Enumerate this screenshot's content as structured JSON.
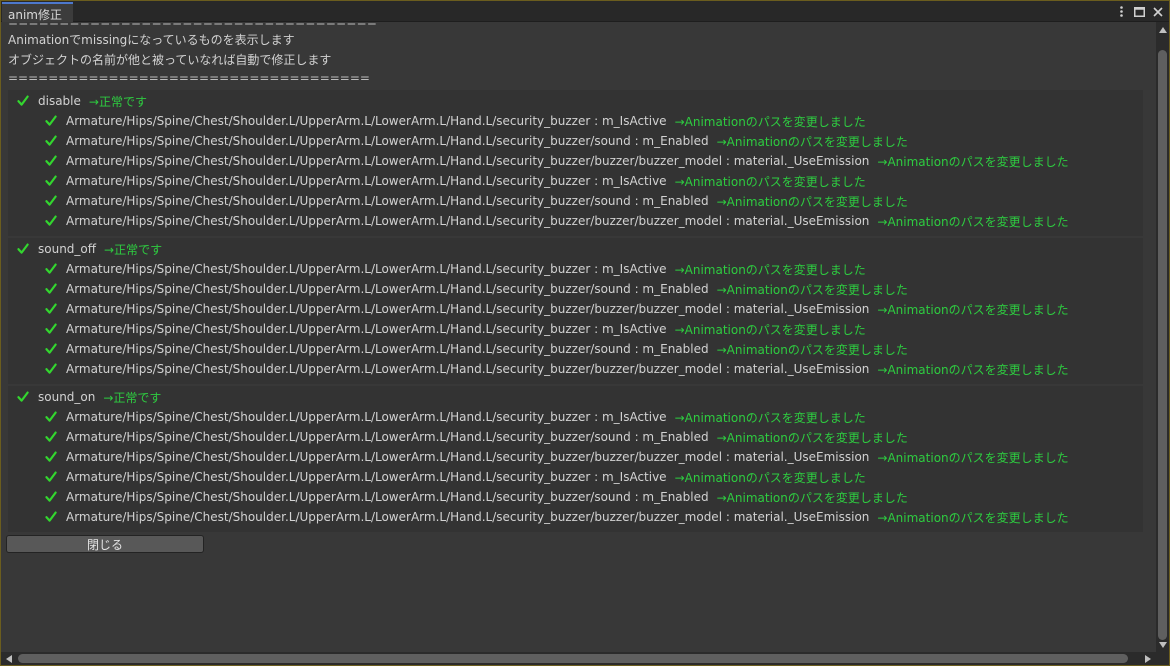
{
  "window": {
    "tab_title": "anim修正",
    "icons": [
      "more-vertical-icon",
      "maximize-icon",
      "close-icon"
    ]
  },
  "header": {
    "divider_top": "====================================",
    "line1": "Animationでmissingになっているものを表示します",
    "line2": "オブジェクトの名前が他と被っていなれば自動で修正します",
    "divider_bottom": "===================================="
  },
  "groups": [
    {
      "name": "disable",
      "status": "→正常です",
      "entries": [
        {
          "path": "Armature/Hips/Spine/Chest/Shoulder.L/UpperArm.L/LowerArm.L/Hand.L/security_buzzer : m_IsActive",
          "status": "→Animationのパスを変更しました"
        },
        {
          "path": "Armature/Hips/Spine/Chest/Shoulder.L/UpperArm.L/LowerArm.L/Hand.L/security_buzzer/sound : m_Enabled",
          "status": "→Animationのパスを変更しました"
        },
        {
          "path": "Armature/Hips/Spine/Chest/Shoulder.L/UpperArm.L/LowerArm.L/Hand.L/security_buzzer/buzzer/buzzer_model : material._UseEmission",
          "status": "→Animationのパスを変更しました"
        },
        {
          "path": "Armature/Hips/Spine/Chest/Shoulder.L/UpperArm.L/LowerArm.L/Hand.L/security_buzzer : m_IsActive",
          "status": "→Animationのパスを変更しました"
        },
        {
          "path": "Armature/Hips/Spine/Chest/Shoulder.L/UpperArm.L/LowerArm.L/Hand.L/security_buzzer/sound : m_Enabled",
          "status": "→Animationのパスを変更しました"
        },
        {
          "path": "Armature/Hips/Spine/Chest/Shoulder.L/UpperArm.L/LowerArm.L/Hand.L/security_buzzer/buzzer/buzzer_model : material._UseEmission",
          "status": "→Animationのパスを変更しました"
        }
      ]
    },
    {
      "name": "sound_off",
      "status": "→正常です",
      "entries": [
        {
          "path": "Armature/Hips/Spine/Chest/Shoulder.L/UpperArm.L/LowerArm.L/Hand.L/security_buzzer : m_IsActive",
          "status": "→Animationのパスを変更しました"
        },
        {
          "path": "Armature/Hips/Spine/Chest/Shoulder.L/UpperArm.L/LowerArm.L/Hand.L/security_buzzer/sound : m_Enabled",
          "status": "→Animationのパスを変更しました"
        },
        {
          "path": "Armature/Hips/Spine/Chest/Shoulder.L/UpperArm.L/LowerArm.L/Hand.L/security_buzzer/buzzer/buzzer_model : material._UseEmission",
          "status": "→Animationのパスを変更しました"
        },
        {
          "path": "Armature/Hips/Spine/Chest/Shoulder.L/UpperArm.L/LowerArm.L/Hand.L/security_buzzer : m_IsActive",
          "status": "→Animationのパスを変更しました"
        },
        {
          "path": "Armature/Hips/Spine/Chest/Shoulder.L/UpperArm.L/LowerArm.L/Hand.L/security_buzzer/sound : m_Enabled",
          "status": "→Animationのパスを変更しました"
        },
        {
          "path": "Armature/Hips/Spine/Chest/Shoulder.L/UpperArm.L/LowerArm.L/Hand.L/security_buzzer/buzzer/buzzer_model : material._UseEmission",
          "status": "→Animationのパスを変更しました"
        }
      ]
    },
    {
      "name": "sound_on",
      "status": "→正常です",
      "entries": [
        {
          "path": "Armature/Hips/Spine/Chest/Shoulder.L/UpperArm.L/LowerArm.L/Hand.L/security_buzzer : m_IsActive",
          "status": "→Animationのパスを変更しました"
        },
        {
          "path": "Armature/Hips/Spine/Chest/Shoulder.L/UpperArm.L/LowerArm.L/Hand.L/security_buzzer/sound : m_Enabled",
          "status": "→Animationのパスを変更しました"
        },
        {
          "path": "Armature/Hips/Spine/Chest/Shoulder.L/UpperArm.L/LowerArm.L/Hand.L/security_buzzer/buzzer/buzzer_model : material._UseEmission",
          "status": "→Animationのパスを変更しました"
        },
        {
          "path": "Armature/Hips/Spine/Chest/Shoulder.L/UpperArm.L/LowerArm.L/Hand.L/security_buzzer : m_IsActive",
          "status": "→Animationのパスを変更しました"
        },
        {
          "path": "Armature/Hips/Spine/Chest/Shoulder.L/UpperArm.L/LowerArm.L/Hand.L/security_buzzer/sound : m_Enabled",
          "status": "→Animationのパスを変更しました"
        },
        {
          "path": "Armature/Hips/Spine/Chest/Shoulder.L/UpperArm.L/LowerArm.L/Hand.L/security_buzzer/buzzer/buzzer_model : material._UseEmission",
          "status": "→Animationのパスを変更しました"
        }
      ]
    }
  ],
  "close_button": {
    "label": "閉じる"
  },
  "colors": {
    "ok_green": "#2ecc40",
    "check_green": "#33d62f",
    "background": "#383838",
    "tab_accent": "#4d78cc"
  }
}
